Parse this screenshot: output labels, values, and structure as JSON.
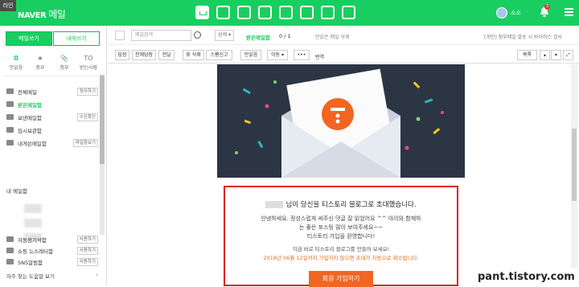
{
  "header": {
    "corner_badge": "라인",
    "logo": "NAVER",
    "logo_sub": "메일",
    "user_name": "소소",
    "notification_count": "3"
  },
  "sidebar": {
    "write_label": "메일쓰기",
    "self_label": "내게쓰기",
    "quick": [
      {
        "value": "0",
        "label": "안읽음"
      },
      {
        "icon": "★",
        "label": "중요"
      },
      {
        "icon": "📎",
        "label": "첨부"
      },
      {
        "icon": "TO",
        "label": "받는사람"
      }
    ],
    "folders": [
      {
        "name": "전체메일",
        "action": "정리하기"
      },
      {
        "name": "받은메일함",
        "action": ""
      },
      {
        "name": "보낸메일함",
        "action": "수신확인"
      },
      {
        "name": "임시보관함",
        "action": ""
      },
      {
        "name": "내게쓴메일함",
        "action": "파일함보기"
      }
    ],
    "my_mailbox": "내 메일함",
    "bottom_folders": [
      {
        "name": "자동정기석함",
        "action": "사용하기"
      },
      {
        "name": "쇼핑 뉴스레터함",
        "action": "사용하기"
      },
      {
        "name": "SNS알림함",
        "action": "사용하기"
      }
    ],
    "faq": "자주 찾는 도움말 보기"
  },
  "toolbar": {
    "search_placeholder": "메일검색",
    "detail_label": "상세 ▾",
    "current_folder": "받은메일함",
    "count": "0 / 1",
    "unread_only": "안읽은 메일 삭제",
    "notice": "[개인] 첨부메일 발송 시 바이러스 검사",
    "buttons": [
      "답장",
      "전체답장",
      "전달",
      "휴 삭제",
      "스팸신고",
      "안읽음",
      "이동 ▾",
      "•••"
    ],
    "translate": "번역",
    "list_label": "목록"
  },
  "email": {
    "title_suffix": "님이 당신을 티스토리 블로그로 초대했습니다.",
    "line1": "안녕하세요. 정성스럽게 써주신 댓글 잘 읽었어요 ^^ 아이와 함께하",
    "line2": "는 좋은 포스팅 많이 보여주세요~~",
    "line3": "티스토리 가입을 환영합니다!",
    "line4": "지금 바로 티스토리 블로그를 만들어 보세요!",
    "line5": "2018년 06월 12일까지 가입하지 않으면 초대가 자동으로 취소됩니다.",
    "join_label": "회원 가입하기",
    "brand_color": "#f26522",
    "highlight_color": "#e02020"
  },
  "watermark": "pant.tistory.com"
}
